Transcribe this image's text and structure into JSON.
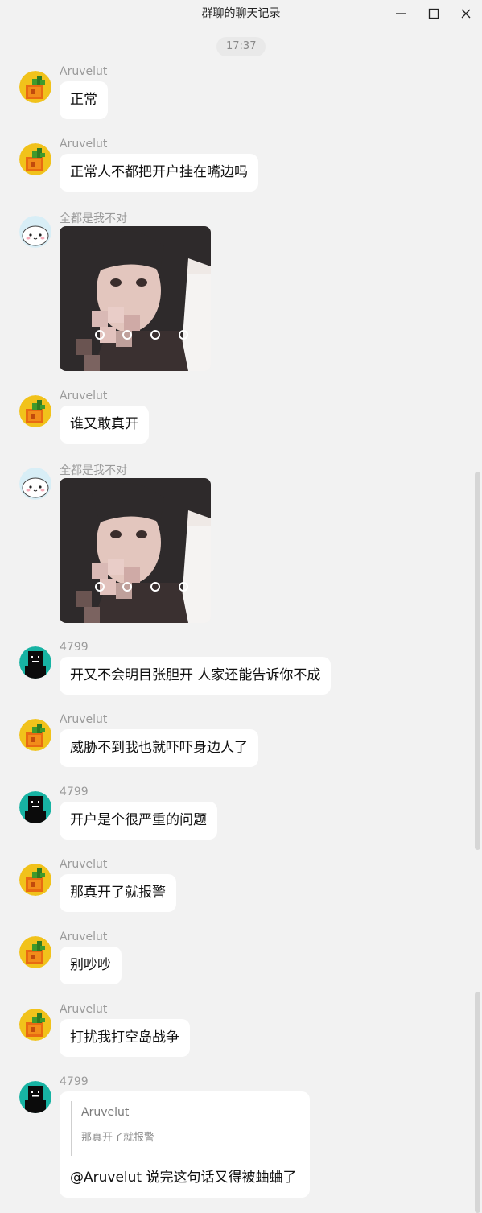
{
  "window": {
    "title": "群聊的聊天记录",
    "icons": [
      "minimize-icon",
      "maximize-icon",
      "close-icon"
    ]
  },
  "chat": {
    "timestamp": "17:37",
    "messages": [
      {
        "sender": "Aruvelut",
        "type": "text",
        "text": "正常",
        "avatar": "pixel-orange-avatar"
      },
      {
        "sender": "Aruvelut",
        "type": "text",
        "text": "正常人不都把开户挂在嘴边吗",
        "avatar": "pixel-orange-avatar"
      },
      {
        "sender": "全都是我不对",
        "type": "image",
        "avatar": "cat-sticker-avatar"
      },
      {
        "sender": "Aruvelut",
        "type": "text",
        "text": "谁又敢真开",
        "avatar": "pixel-orange-avatar"
      },
      {
        "sender": "全都是我不对",
        "type": "image",
        "avatar": "cat-sticker-avatar"
      },
      {
        "sender": "4799",
        "type": "text",
        "text": "开又不会明目张胆开 人家还能告诉你不成",
        "avatar": "black-block-avatar"
      },
      {
        "sender": "Aruvelut",
        "type": "text",
        "text": "威胁不到我也就吓吓身边人了",
        "avatar": "pixel-orange-avatar"
      },
      {
        "sender": "4799",
        "type": "text",
        "text": "开户是个很严重的问题",
        "avatar": "black-block-avatar"
      },
      {
        "sender": "Aruvelut",
        "type": "text",
        "text": "那真开了就报警",
        "avatar": "pixel-orange-avatar"
      },
      {
        "sender": "Aruvelut",
        "type": "text",
        "text": "别吵吵",
        "avatar": "pixel-orange-avatar"
      },
      {
        "sender": "Aruvelut",
        "type": "text",
        "text": "打扰我打空岛战争",
        "avatar": "pixel-orange-avatar"
      },
      {
        "sender": "4799",
        "type": "reply",
        "avatar": "black-block-avatar",
        "quote": {
          "sender": "Aruvelut",
          "text": "那真开了就报警"
        },
        "text": "@Aruvelut 说完这句话又得被蛐蛐了"
      }
    ]
  },
  "colors": {
    "background": "#f2f2f2",
    "bubble": "#ffffff",
    "sender_name": "#9a9a9a",
    "timestamp_pill": "#e9e9e9"
  }
}
